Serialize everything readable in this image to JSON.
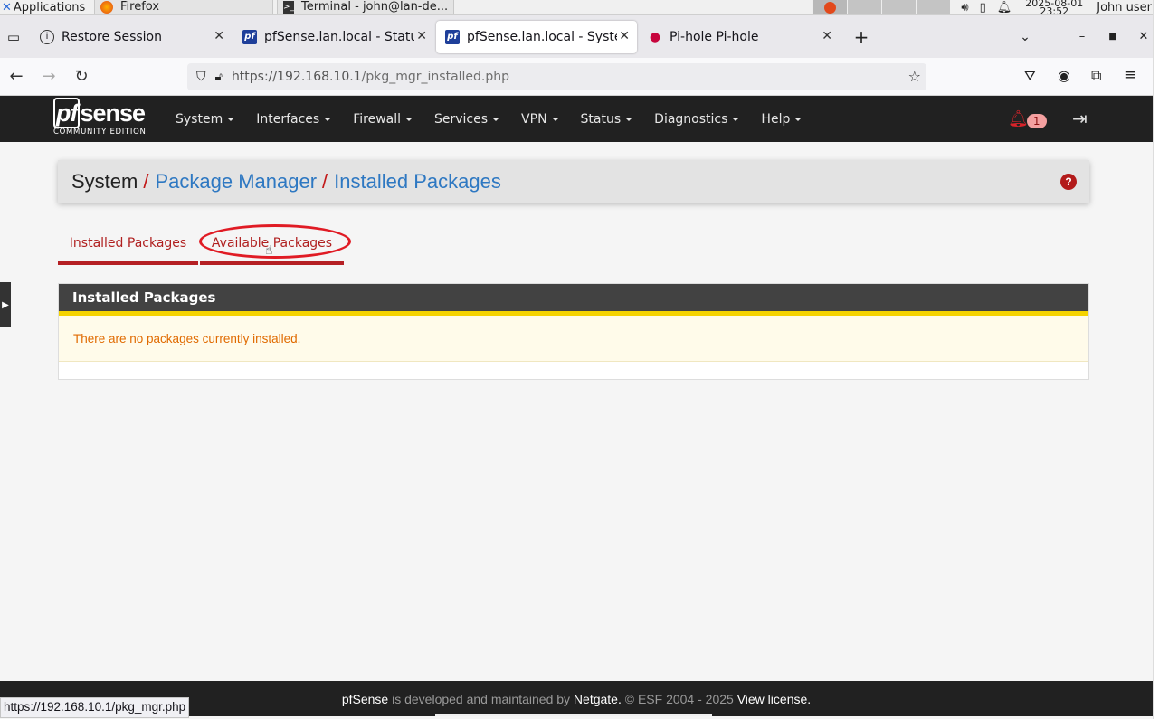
{
  "taskbar": {
    "apps_label": "Applications",
    "firefox_label": "Firefox",
    "terminal_label": "Terminal - john@lan-de...",
    "clock_date": "2025-08-01",
    "clock_time": "23:52",
    "user_label": "John user"
  },
  "browser": {
    "tabs": [
      {
        "title": "Restore Session"
      },
      {
        "title": "pfSense.lan.local - Status"
      },
      {
        "title": "pfSense.lan.local - System"
      },
      {
        "title": "Pi-hole Pi-hole"
      }
    ],
    "url_host": "https://192.168.10.1",
    "url_path": "/pkg_mgr_installed.php",
    "status_url": "https://192.168.10.1/pkg_mgr.php"
  },
  "pfsense": {
    "logo_main": "sense",
    "logo_pf": "pf",
    "logo_sub": "COMMUNITY EDITION",
    "menu": [
      "System",
      "Interfaces",
      "Firewall",
      "Services",
      "VPN",
      "Status",
      "Diagnostics",
      "Help"
    ],
    "alert_count": "1",
    "breadcrumb": {
      "root": "System",
      "level1": "Package Manager",
      "level2": "Installed Packages",
      "sep": "/"
    },
    "help_label": "?",
    "tabs": [
      "Installed Packages",
      "Available Packages"
    ],
    "panel_title": "Installed Packages",
    "panel_message": "There are no packages currently installed.",
    "footer": {
      "brand": "pfSense",
      "text1": "is developed and maintained by",
      "company": "Netgate.",
      "text2": "© ESF 2004 - 2025",
      "license": "View license."
    }
  },
  "colors": {
    "accent_red": "#b52024",
    "link_blue": "#2e78c2",
    "header_dark": "#212121",
    "warning_text": "#e06a00",
    "panel_stripe": "#f5d300"
  }
}
